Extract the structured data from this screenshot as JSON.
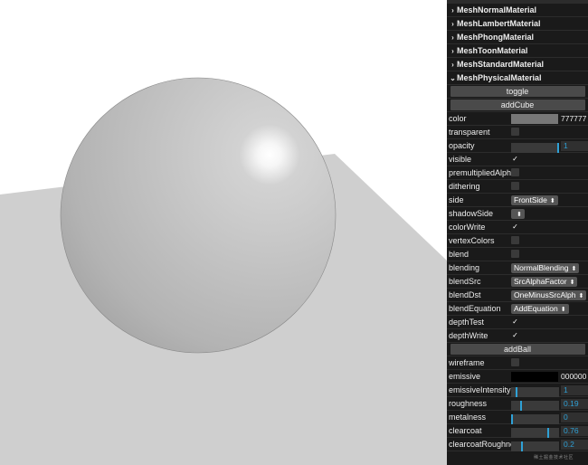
{
  "folders": [
    {
      "label": "MeshNormalMaterial",
      "open": false
    },
    {
      "label": "MeshLambertMaterial",
      "open": false
    },
    {
      "label": "MeshPhongMaterial",
      "open": false
    },
    {
      "label": "MeshToonMaterial",
      "open": false
    },
    {
      "label": "MeshStandardMaterial",
      "open": false
    },
    {
      "label": "MeshPhysicalMaterial",
      "open": true
    }
  ],
  "buttons": {
    "toggle": "toggle",
    "addCube": "addCube",
    "addBall": "addBall"
  },
  "cube": {
    "color": {
      "label": "color",
      "value": "777777",
      "swatch": "#777777"
    },
    "transparent": {
      "label": "transparent",
      "checked": false
    },
    "opacity": {
      "label": "opacity",
      "value": "1",
      "fraction": 1
    },
    "visible": {
      "label": "visible",
      "checked": true
    },
    "premultipliedAlpha": {
      "label": "premultipliedAlpha",
      "checked": false
    },
    "dithering": {
      "label": "dithering",
      "checked": false
    },
    "side": {
      "label": "side",
      "value": "FrontSide"
    },
    "shadowSide": {
      "label": "shadowSide",
      "value": ""
    },
    "colorWrite": {
      "label": "colorWrite",
      "checked": true
    },
    "vertexColors": {
      "label": "vertexColors",
      "checked": false
    },
    "blend": {
      "label": "blend",
      "checked": false
    },
    "blending": {
      "label": "blending",
      "value": "NormalBlending"
    },
    "blendSrc": {
      "label": "blendSrc",
      "value": "SrcAlphaFactor"
    },
    "blendDst": {
      "label": "blendDst",
      "value": "OneMinusSrcAlph"
    },
    "blendEquation": {
      "label": "blendEquation",
      "value": "AddEquation"
    },
    "depthTest": {
      "label": "depthTest",
      "checked": true
    },
    "depthWrite": {
      "label": "depthWrite",
      "checked": true
    }
  },
  "ball": {
    "wireframe": {
      "label": "wireframe",
      "checked": false
    },
    "emissive": {
      "label": "emissive",
      "value": "000000",
      "swatch": "#000000"
    },
    "emissiveIntensity": {
      "label": "emissiveIntensity",
      "value": "1",
      "fraction": 0.1
    },
    "roughness": {
      "label": "roughness",
      "value": "0.19",
      "fraction": 0.19
    },
    "metalness": {
      "label": "metalness",
      "value": "0",
      "fraction": 0
    },
    "clearcoat": {
      "label": "clearcoat",
      "value": "0.76",
      "fraction": 0.76
    },
    "clearcoatRoughness": {
      "label": "clearcoatRoughness",
      "value": "0.2",
      "fraction": 0.2
    }
  },
  "watermark": "稀土掘金技术社区",
  "colors": {
    "panel": "#1a1a1a",
    "button": "#4a4a4a",
    "accent": "#2fa1d6",
    "plane": "#cfcfcf"
  }
}
